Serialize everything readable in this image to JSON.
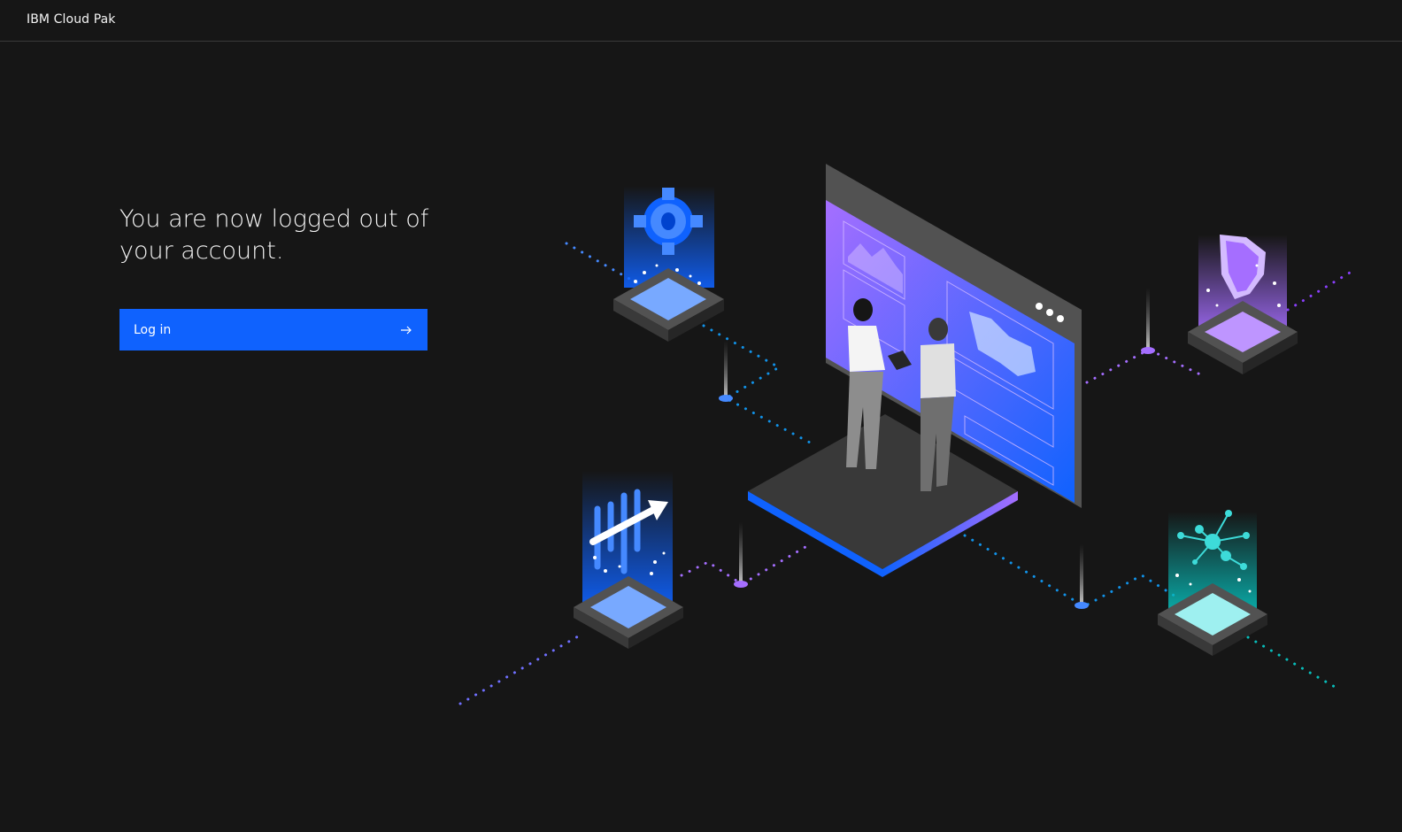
{
  "header": {
    "brand": "IBM Cloud Pak"
  },
  "main": {
    "title": "You are now logged out of your account.",
    "login_label": "Log in",
    "login_icon": "arrow-right-icon"
  },
  "colors": {
    "background": "#161616",
    "primary": "#0f62fe",
    "purple": "#a56eff",
    "teal": "#3ddbd9",
    "blue": "#4589ff"
  }
}
